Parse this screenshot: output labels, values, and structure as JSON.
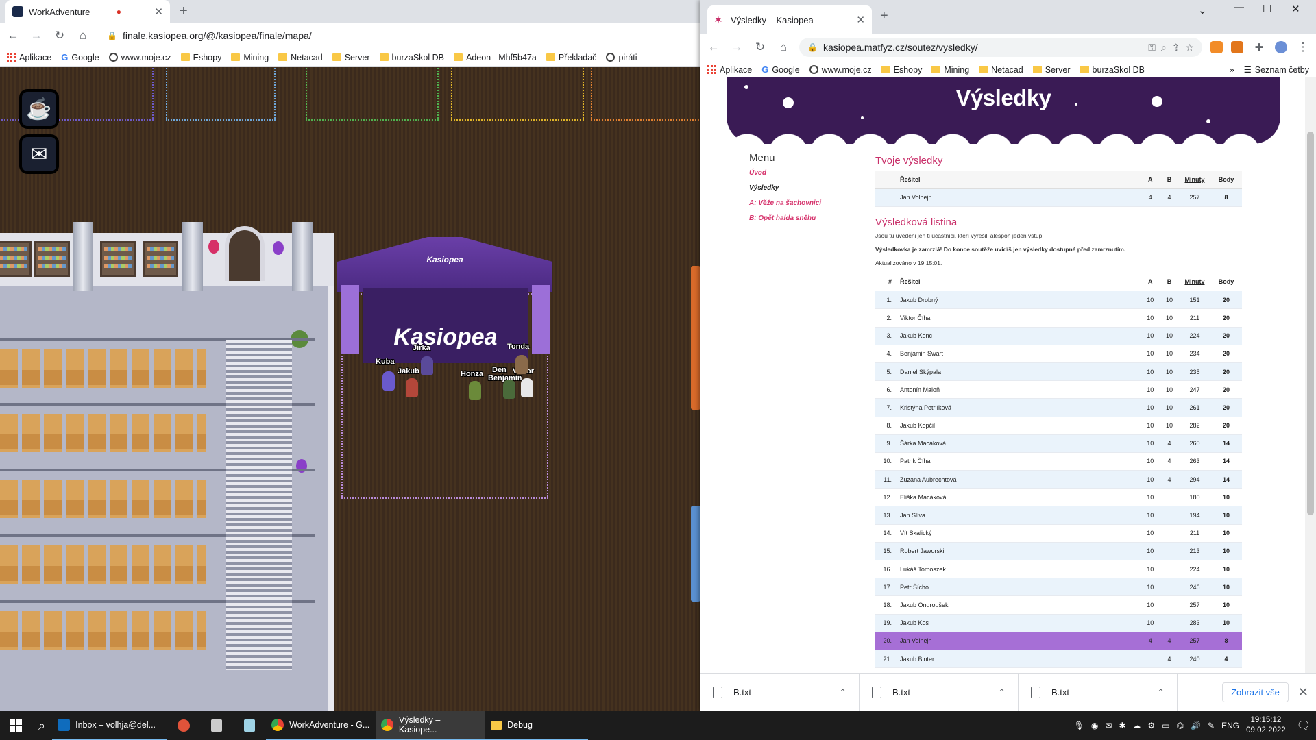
{
  "left_browser": {
    "tab_title": "WorkAdventure",
    "url": "finale.kasiopea.org/@/kasiopea/finale/mapa/",
    "bookmarks": [
      "Aplikace",
      "Google",
      "www.moje.cz",
      "Eshopy",
      "Mining",
      "Netacad",
      "Server",
      "burzaSkol DB",
      "Adeon - Mhf5b47a",
      "Překladač",
      "piráti"
    ]
  },
  "game": {
    "tent_roof_label": "Kasiopea",
    "tent_banner": "Kasiopea",
    "avatars": [
      {
        "name": "Kuba"
      },
      {
        "name": "Jirka"
      },
      {
        "name": "Jakub"
      },
      {
        "name": "Tonda"
      },
      {
        "name": "Honza"
      },
      {
        "name": "Den"
      },
      {
        "name": "Viktor"
      },
      {
        "name": "Benjamin"
      }
    ],
    "coffee_icon": "coffee-cup-icon",
    "mail_icon": "envelope-icon"
  },
  "right_browser": {
    "tab_title": "Výsledky – Kasiopea",
    "url": "kasiopea.matfyz.cz/soutez/vysledky/",
    "bookmarks": [
      "Aplikace",
      "Google",
      "www.moje.cz",
      "Eshopy",
      "Mining",
      "Netacad",
      "Server",
      "burzaSkol DB"
    ],
    "reading_list": "Seznam četby",
    "more_bookmarks": "»"
  },
  "page": {
    "hero_title": "Výsledky",
    "menu": {
      "title": "Menu",
      "items": [
        "Úvod",
        "Výsledky",
        "A: Věže na šachovnici",
        "B: Opět halda sněhu"
      ],
      "active_index": 1
    },
    "your_results": {
      "heading": "Tvoje výsledky",
      "columns": [
        "Řešitel",
        "A",
        "B",
        "Minuty",
        "Body"
      ],
      "row": {
        "name": "Jan Volhejn",
        "a": "4",
        "b": "4",
        "minutes": "257",
        "points": "8"
      }
    },
    "leaderboard": {
      "heading": "Výsledková listina",
      "note1": "Jsou tu uvedeni jen ti účastníci, kteří vyřešili alespoň jeden vstup.",
      "note2": "Výsledkovka je zamrzlá! Do konce soutěže uvidíš jen výsledky dostupné před zamrznutím.",
      "updated": "Aktualizováno v 19:15:01.",
      "columns": [
        "#",
        "Řešitel",
        "A",
        "B",
        "Minuty",
        "Body"
      ],
      "rows": [
        {
          "rank": "1.",
          "name": "Jakub Drobný",
          "a": "10",
          "b": "10",
          "minutes": "151",
          "points": "20"
        },
        {
          "rank": "2.",
          "name": "Viktor Číhal",
          "a": "10",
          "b": "10",
          "minutes": "211",
          "points": "20"
        },
        {
          "rank": "3.",
          "name": "Jakub Konc",
          "a": "10",
          "b": "10",
          "minutes": "224",
          "points": "20"
        },
        {
          "rank": "4.",
          "name": "Benjamin Swart",
          "a": "10",
          "b": "10",
          "minutes": "234",
          "points": "20"
        },
        {
          "rank": "5.",
          "name": "Daniel Skýpala",
          "a": "10",
          "b": "10",
          "minutes": "235",
          "points": "20"
        },
        {
          "rank": "6.",
          "name": "Antonín Maloň",
          "a": "10",
          "b": "10",
          "minutes": "247",
          "points": "20"
        },
        {
          "rank": "7.",
          "name": "Kristýna Petrlíková",
          "a": "10",
          "b": "10",
          "minutes": "261",
          "points": "20"
        },
        {
          "rank": "8.",
          "name": "Jakub Kopčil",
          "a": "10",
          "b": "10",
          "minutes": "282",
          "points": "20"
        },
        {
          "rank": "9.",
          "name": "Šárka Macáková",
          "a": "10",
          "b": "4",
          "minutes": "260",
          "points": "14"
        },
        {
          "rank": "10.",
          "name": "Patrik Číhal",
          "a": "10",
          "b": "4",
          "minutes": "263",
          "points": "14"
        },
        {
          "rank": "11.",
          "name": "Zuzana Aubrechtová",
          "a": "10",
          "b": "4",
          "minutes": "294",
          "points": "14"
        },
        {
          "rank": "12.",
          "name": "Eliška Macáková",
          "a": "10",
          "b": "",
          "minutes": "180",
          "points": "10"
        },
        {
          "rank": "13.",
          "name": "Jan Slíva",
          "a": "10",
          "b": "",
          "minutes": "194",
          "points": "10"
        },
        {
          "rank": "14.",
          "name": "Vít Skalický",
          "a": "10",
          "b": "",
          "minutes": "211",
          "points": "10"
        },
        {
          "rank": "15.",
          "name": "Robert Jaworski",
          "a": "10",
          "b": "",
          "minutes": "213",
          "points": "10"
        },
        {
          "rank": "16.",
          "name": "Lukáš Tomoszek",
          "a": "10",
          "b": "",
          "minutes": "224",
          "points": "10"
        },
        {
          "rank": "17.",
          "name": "Petr Šícho",
          "a": "10",
          "b": "",
          "minutes": "246",
          "points": "10"
        },
        {
          "rank": "18.",
          "name": "Jakub Ondroušek",
          "a": "10",
          "b": "",
          "minutes": "257",
          "points": "10"
        },
        {
          "rank": "19.",
          "name": "Jakub Kos",
          "a": "10",
          "b": "",
          "minutes": "283",
          "points": "10"
        },
        {
          "rank": "20.",
          "name": "Jan Volhejn",
          "a": "4",
          "b": "4",
          "minutes": "257",
          "points": "8",
          "highlight": true
        },
        {
          "rank": "21.",
          "name": "Jakub Binter",
          "a": "",
          "b": "4",
          "minutes": "240",
          "points": "4"
        }
      ]
    }
  },
  "downloads": {
    "items": [
      "B.txt",
      "B.txt",
      "B.txt"
    ],
    "show_all": "Zobrazit vše"
  },
  "taskbar": {
    "apps": [
      {
        "label": "Inbox – volhja@del...",
        "icon": "outlook-icon"
      },
      {
        "label": "",
        "icon": "app-icon"
      },
      {
        "label": "",
        "icon": "calculator-icon"
      },
      {
        "label": "",
        "icon": "notes-icon"
      },
      {
        "label": "WorkAdventure - G...",
        "icon": "chrome-icon"
      },
      {
        "label": "Výsledky – Kasiope...",
        "icon": "chrome-icon"
      },
      {
        "label": "Debug",
        "icon": "folder-icon"
      }
    ],
    "language": "ENG",
    "time": "19:15:12",
    "date": "09.02.2022"
  }
}
